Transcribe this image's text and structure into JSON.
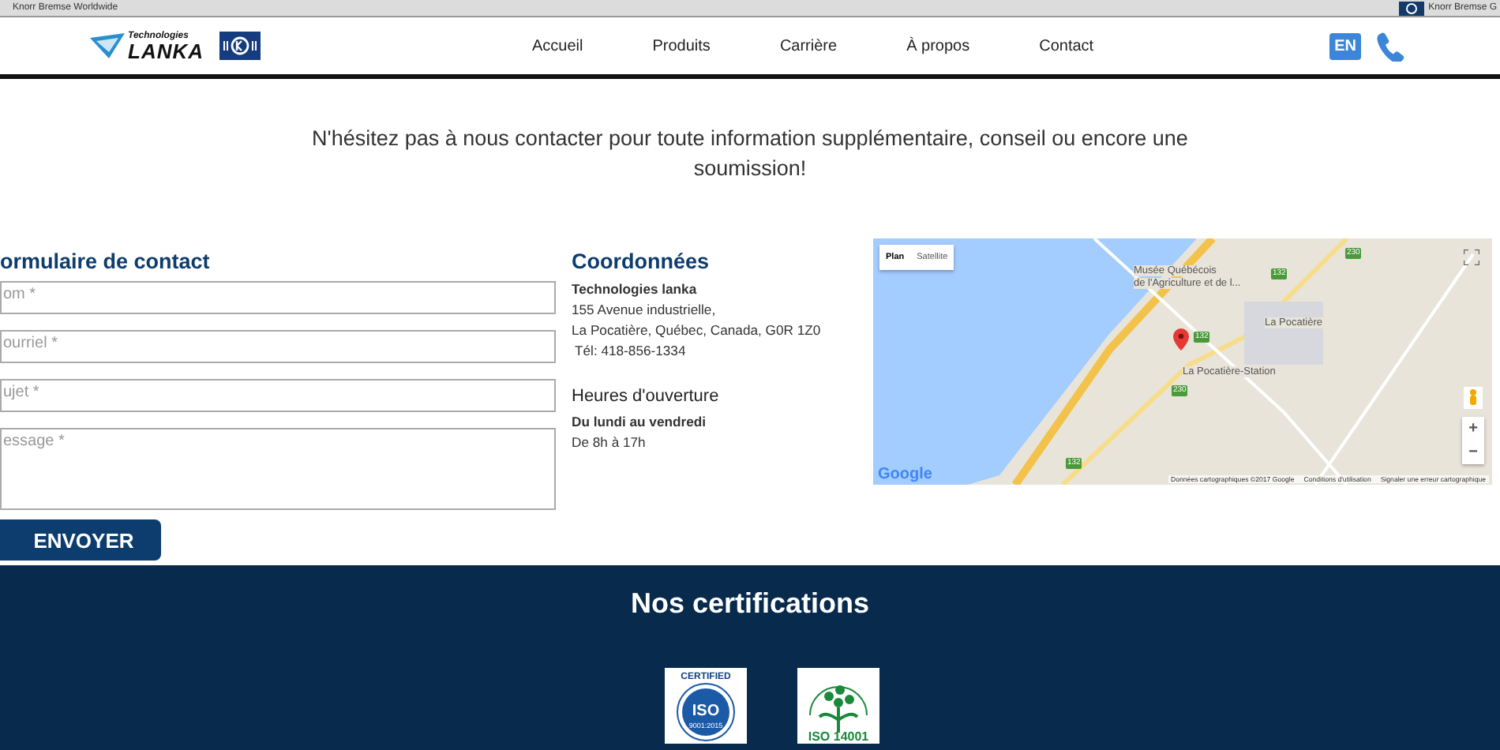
{
  "browser_bar": {
    "left_text": "Knorr Bremse Worldwide",
    "right_text": "Knorr Bremse G"
  },
  "header": {
    "logo_small": "Technologies",
    "logo_big": "LANKA",
    "nav": [
      {
        "label": "Accueil"
      },
      {
        "label": "Produits"
      },
      {
        "label": "Carrière"
      },
      {
        "label": "À propos"
      },
      {
        "label": "Contact"
      }
    ],
    "language": "EN"
  },
  "intro": "N'hésitez pas à nous contacter pour toute information supplémentaire, conseil ou encore une soumission!",
  "form": {
    "title": "ormulaire de contact",
    "fields": [
      {
        "kind": "input",
        "placeholder": "om *"
      },
      {
        "kind": "input",
        "placeholder": "ourriel *"
      },
      {
        "kind": "input",
        "placeholder": "ujet *"
      },
      {
        "kind": "textarea",
        "placeholder": "essage *"
      }
    ],
    "submit": "ENVOYER"
  },
  "contact": {
    "title": "Coordonnées",
    "company": "Technologies lanka",
    "lines": [
      "155 Avenue industrielle,",
      "La Pocatière, Québec, Canada, G0R 1Z0",
      "Tél: 418-856-1334"
    ],
    "hours_title": "Heures d'ouverture",
    "days": "Du lundi au vendredi",
    "hours": "De 8h à 17h"
  },
  "map": {
    "map_types": [
      {
        "label": "Plan",
        "selected": true
      },
      {
        "label": "Satellite",
        "selected": false
      }
    ],
    "places": [
      "Musée Québécois",
      "de l'Agriculture et de l...",
      "La Pocatière",
      "La Pocatière-Station"
    ],
    "shields": [
      "230",
      "132",
      "132",
      "230",
      "132"
    ],
    "zoom_in": "+",
    "zoom_out": "−",
    "brand": "Google",
    "attribution": [
      "Données cartographiques ©2017 Google",
      "Conditions d'utilisation",
      "Signaler une erreur cartographique"
    ]
  },
  "footer": {
    "title": "Nos certifications",
    "certs": [
      {
        "kind": "iso9001",
        "top": "CERTIFIED",
        "main": "ISO",
        "sub": "9001:2015"
      },
      {
        "kind": "iso14001",
        "main": "ISO 14001"
      }
    ]
  }
}
